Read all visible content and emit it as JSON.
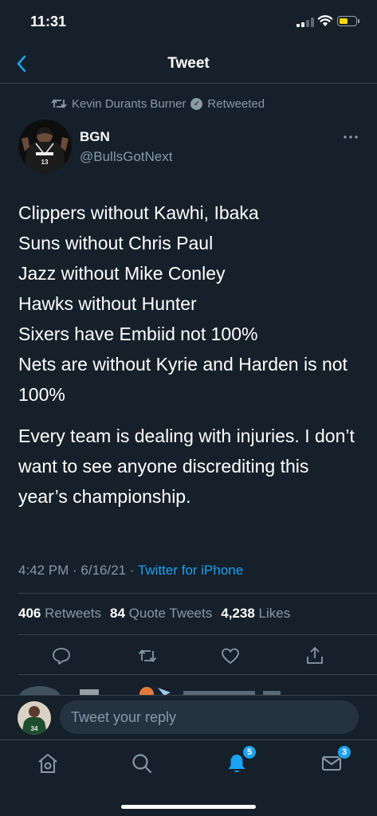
{
  "status_bar": {
    "time": "11:31"
  },
  "header": {
    "title": "Tweet"
  },
  "retweet_context": {
    "text": "Kevin Durants Burner",
    "suffix": "Retweeted"
  },
  "author": {
    "name": "BGN",
    "handle": "@BullsGotNext"
  },
  "tweet": {
    "lines": [
      "Clippers without Kawhi, Ibaka",
      "Suns without Chris Paul",
      "Jazz without Mike Conley",
      "Hawks without Hunter",
      "Sixers have Embiid not 100%",
      "Nets are without Kyrie and Harden is not 100%"
    ],
    "paragraph2": "Every team is dealing with injuries. I don’t want to see anyone discrediting this year’s championship.",
    "timestamp": "4:42 PM · 6/16/21 · ",
    "source": "Twitter for iPhone"
  },
  "stats": {
    "retweets_count": "406",
    "retweets_label": "Retweets",
    "quotes_count": "84",
    "quotes_label": "Quote Tweets",
    "likes_count": "4,238",
    "likes_label": "Likes"
  },
  "reply": {
    "placeholder": "Tweet your reply"
  },
  "tab_bar": {
    "notifications_badge": "5",
    "messages_badge": "3"
  },
  "icons": {
    "back": "chevron-left-icon",
    "retweet": "retweet-icon",
    "verified": "verified-badge-icon",
    "more": "more-horizontal-icon",
    "reply": "comment-icon",
    "like": "heart-icon",
    "share": "share-icon",
    "home": "home-icon",
    "search": "search-icon",
    "notifications": "bell-icon",
    "messages": "mail-icon"
  },
  "colors": {
    "background": "#15202b",
    "accent": "#1da1f2",
    "secondary_text": "#8899a6",
    "divider": "#38444d"
  }
}
